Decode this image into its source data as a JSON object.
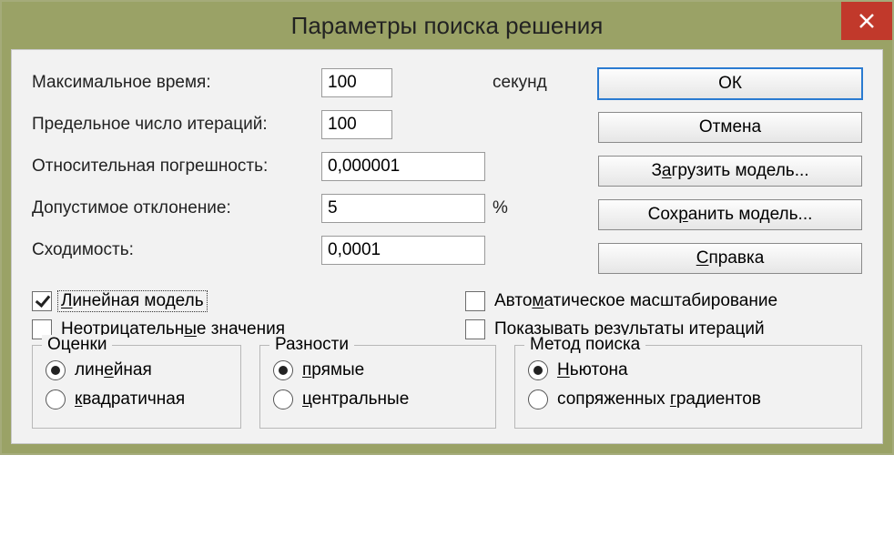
{
  "window": {
    "title": "Параметры поиска решения"
  },
  "labels": {
    "max_time": "Максимальное время:",
    "max_iter": "Предельное число итераций:",
    "tolerance": "Относительная погрешность:",
    "allow_dev": "Допустимое отклонение:",
    "convergence": "Сходимость:",
    "seconds": "секунд",
    "percent": "%"
  },
  "values": {
    "max_time": "100",
    "max_iter": "100",
    "tolerance": "0,000001",
    "allow_dev": "5",
    "convergence": "0,0001"
  },
  "buttons": {
    "ok": "ОК",
    "cancel": "Отмена",
    "load_pre": "З",
    "load_u": "а",
    "load_post": "грузить модель...",
    "save_pre": "Сох",
    "save_u": "р",
    "save_post": "анить модель...",
    "help_pre": "",
    "help_u": "С",
    "help_post": "правка"
  },
  "checks": {
    "linear_pre": "",
    "linear_u": "Л",
    "linear_post": "инейная модель",
    "autoscale_pre": "Авто",
    "autoscale_u": "м",
    "autoscale_post": "атическое масштабирование",
    "nonneg_pre": "Неотрицательн",
    "nonneg_u": "ы",
    "nonneg_post": "е значения",
    "showiter_pre": "Показывать р",
    "showiter_u": "е",
    "showiter_post": "зультаты итераций"
  },
  "groups": {
    "estimates": "Оценки",
    "est_linear_pre": "лин",
    "est_linear_u": "е",
    "est_linear_post": "йная",
    "est_quad_pre": "",
    "est_quad_u": "к",
    "est_quad_post": "вадратичная",
    "diffs": "Разности",
    "diff_fwd_pre": "",
    "diff_fwd_u": "п",
    "diff_fwd_post": "рямые",
    "diff_cent_pre": "",
    "diff_cent_u": "ц",
    "diff_cent_post": "ентральные",
    "search": "Метод поиска",
    "sr_newton_pre": "",
    "sr_newton_u": "Н",
    "sr_newton_post": "ьютона",
    "sr_conj_pre": "сопряженных ",
    "sr_conj_u": "г",
    "sr_conj_post": "радиентов"
  }
}
